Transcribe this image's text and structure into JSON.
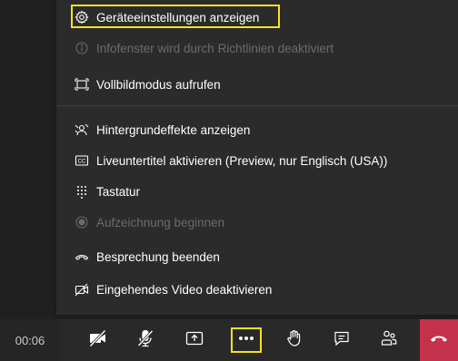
{
  "menu": {
    "items": [
      {
        "label": "Geräteeinstellungen anzeigen",
        "icon": "gear-icon",
        "disabled": false
      },
      {
        "label": "Infofenster wird durch Richtlinien deaktiviert",
        "icon": "info-icon",
        "disabled": true
      },
      {
        "label": "Vollbildmodus aufrufen",
        "icon": "fullscreen-icon",
        "disabled": false
      },
      {
        "label": "Hintergrundeffekte anzeigen",
        "icon": "background-effects-icon",
        "disabled": false
      },
      {
        "label": "Liveuntertitel aktivieren (Preview, nur Englisch (USA))",
        "icon": "closed-captions-icon",
        "disabled": false
      },
      {
        "label": "Tastatur",
        "icon": "keypad-icon",
        "disabled": false
      },
      {
        "label": "Aufzeichnung beginnen",
        "icon": "record-icon",
        "disabled": true
      },
      {
        "label": "Besprechung beenden",
        "icon": "end-meeting-icon",
        "disabled": false
      },
      {
        "label": "Eingehendes Video deaktivieren",
        "icon": "video-off-icon",
        "disabled": false
      }
    ]
  },
  "toolbar": {
    "timer": "00:06",
    "buttons": [
      {
        "name": "camera-off-button",
        "icon": "camera-off-icon"
      },
      {
        "name": "mic-off-button",
        "icon": "mic-off-icon"
      },
      {
        "name": "share-button",
        "icon": "share-icon"
      },
      {
        "name": "more-actions-button",
        "icon": "more-icon"
      },
      {
        "name": "raise-hand-button",
        "icon": "hand-icon"
      },
      {
        "name": "chat-button",
        "icon": "chat-icon"
      },
      {
        "name": "participants-button",
        "icon": "participants-icon"
      },
      {
        "name": "hang-up-button",
        "icon": "phone-hangup-icon"
      }
    ]
  },
  "colors": {
    "highlight": "#f5e320",
    "hangup": "#c4314b",
    "menu_bg": "#2b2b2b",
    "disabled_text": "#6b6b6b"
  }
}
